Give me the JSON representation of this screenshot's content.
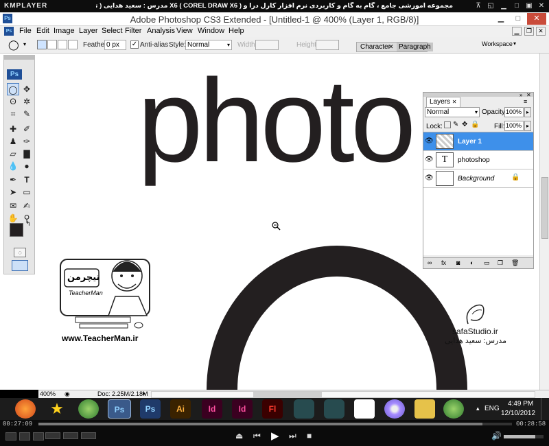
{
  "kmplayer": {
    "logo": "KMPLAYER",
    "title": "مجموعه آموزشی جامع ، گام به گام و کاربردی نرم افزار کارل درا و X6  ( COREL DRAW X6 )   مدرس : سعید هدایی ( تیچرمن ) گروه آموزشی پادشاه گرافیست ها",
    "time_elapsed": "00:27:09",
    "time_total": "00:28:58",
    "progress": 0.937,
    "volume": 0.8
  },
  "photoshop": {
    "window_title": "Adobe Photoshop CS3 Extended - [Untitled-1 @ 400% (Layer 1, RGB/8)]",
    "menu": [
      "File",
      "Edit",
      "Image",
      "Layer",
      "Select",
      "Filter",
      "Analysis",
      "View",
      "Window",
      "Help"
    ],
    "options": {
      "feather_label": "Feather:",
      "feather_value": "0 px",
      "antialias_label": "Anti-alias",
      "style_label": "Style:",
      "style_value": "Normal",
      "width_label": "Width:",
      "height_label": "Height:",
      "workspace_label": "Workspace"
    },
    "panel_tabs": [
      "Character",
      "Paragraph"
    ],
    "canvas_text": "photo",
    "status": {
      "zoom": "400%",
      "doc": "Doc: 2.25M/2.18M"
    },
    "layers": {
      "tab": "Layers",
      "blend_mode": "Normal",
      "opacity_label": "Opacity:",
      "opacity_value": "100%",
      "lock_label": "Lock:",
      "fill_label": "Fill:",
      "fill_value": "100%",
      "items": [
        {
          "name": "Layer 1",
          "thumb": "",
          "selected": true
        },
        {
          "name": "photoshop",
          "thumb": "T",
          "selected": false
        },
        {
          "name": "Background",
          "thumb": "",
          "selected": false
        }
      ]
    }
  },
  "watermarks": {
    "left_url": "www.TeacherMan.ir",
    "left_logo": "تیچرمن",
    "left_logo_sub": "TeacherMan",
    "right_site": "safaStudio.ir",
    "right_teacher": "مدرس: سعید هدایی"
  },
  "taskbar": {
    "icons": [
      "firefox-icon",
      "star-icon",
      "corel-icon",
      "photoshop-icon",
      "photoshop-icon",
      "illustrator-icon",
      "indesign-icon",
      "indesign-icon",
      "flash-icon",
      "app-icon",
      "app-icon",
      "acrobat-icon",
      "dvd-icon",
      "folder-icon",
      "corel-icon"
    ],
    "icon_labels": [
      "",
      "",
      "",
      "Ps",
      "Ps",
      "Ai",
      "Id",
      "Id",
      "Fl",
      "",
      "",
      "",
      "",
      "",
      ""
    ],
    "language": "ENG",
    "time": "4:49 PM",
    "date": "12/10/2012"
  }
}
